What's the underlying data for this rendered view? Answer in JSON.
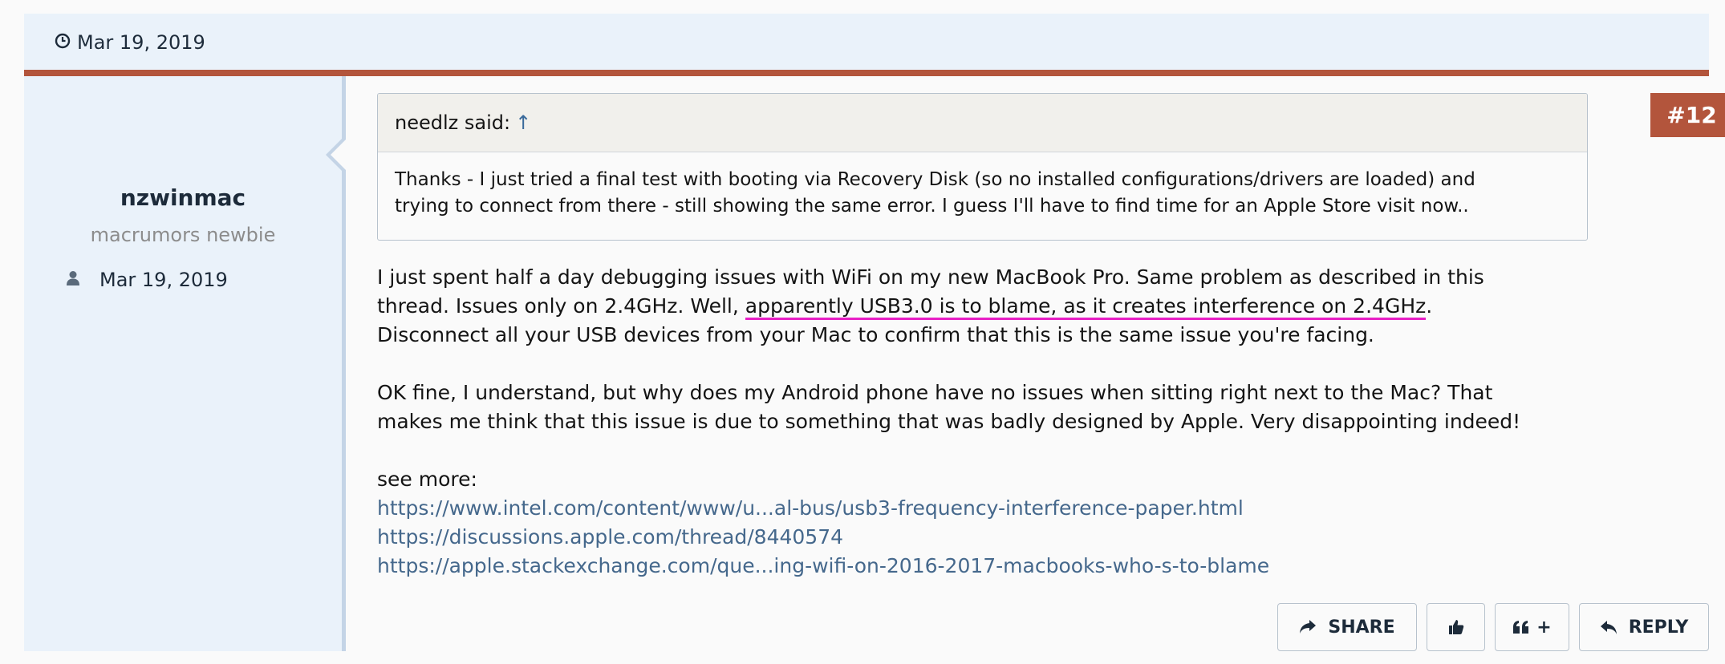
{
  "post": {
    "date": "Mar 19, 2019",
    "number": "#12"
  },
  "user": {
    "name": "nzwinmac",
    "title": "macrumors newbie",
    "joined": "Mar 19, 2019"
  },
  "quote": {
    "author_label": "needlz said:",
    "arrow": "↑",
    "lines": [
      "Thanks - I just tried a final test with booting via Recovery Disk (so no installed configurations/drivers are loaded) and",
      "trying to connect from there - still showing the same error. I guess I'll have to find time for an Apple Store visit now.."
    ]
  },
  "message": {
    "p1_line1": "I just spent half a day debugging issues with WiFi on my new MacBook Pro. Same problem as described in this",
    "p1_line2_pre": "thread. Issues only on 2.4GHz. Well, ",
    "p1_line2_highlight": "apparently USB3.0 is to blame, as it creates interference on 2.4GHz",
    "p1_line2_post": ".",
    "p1_line3": "Disconnect all your USB devices from your Mac to confirm that this is the same issue you're facing.",
    "p2_line1": "OK fine, I understand, but why does my Android phone have no issues when sitting right next to the Mac? That",
    "p2_line2": "makes me think that this issue is due to something that was badly designed by Apple. Very disappointing indeed!",
    "see_more": "see more:",
    "links": [
      "https://www.intel.com/content/www/u...al-bus/usb3-frequency-interference-paper.html",
      "https://discussions.apple.com/thread/8440574",
      "https://apple.stackexchange.com/que...ing-wifi-on-2016-2017-macbooks-who-s-to-blame"
    ]
  },
  "actions": {
    "share": "SHARE",
    "quote_plus": "+",
    "reply": "REPLY"
  },
  "colors": {
    "accent": "#b3553c",
    "header_bg": "#eaf2fa",
    "link": "#45688c",
    "annotation": "#e81fc5"
  },
  "icons": [
    "clock-icon",
    "user-icon",
    "share-icon",
    "thumbs-up-icon",
    "quote-icon",
    "reply-icon"
  ]
}
